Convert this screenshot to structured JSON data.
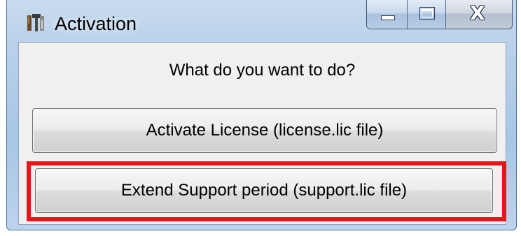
{
  "window": {
    "title": "Activation",
    "icon": "app-tools-icon",
    "caption_buttons": {
      "minimize": "minimize-icon",
      "maximize": "maximize-icon",
      "close_glyph": "X"
    }
  },
  "dialog": {
    "question": "What do you want to do?",
    "buttons": {
      "activate_label": "Activate License (license.lic file)",
      "extend_label": "Extend Support period (support.lic file)"
    }
  },
  "colors": {
    "highlight": "#e8141c",
    "client_bg": "#f0f0f0",
    "frame": "#b9d1ea"
  }
}
